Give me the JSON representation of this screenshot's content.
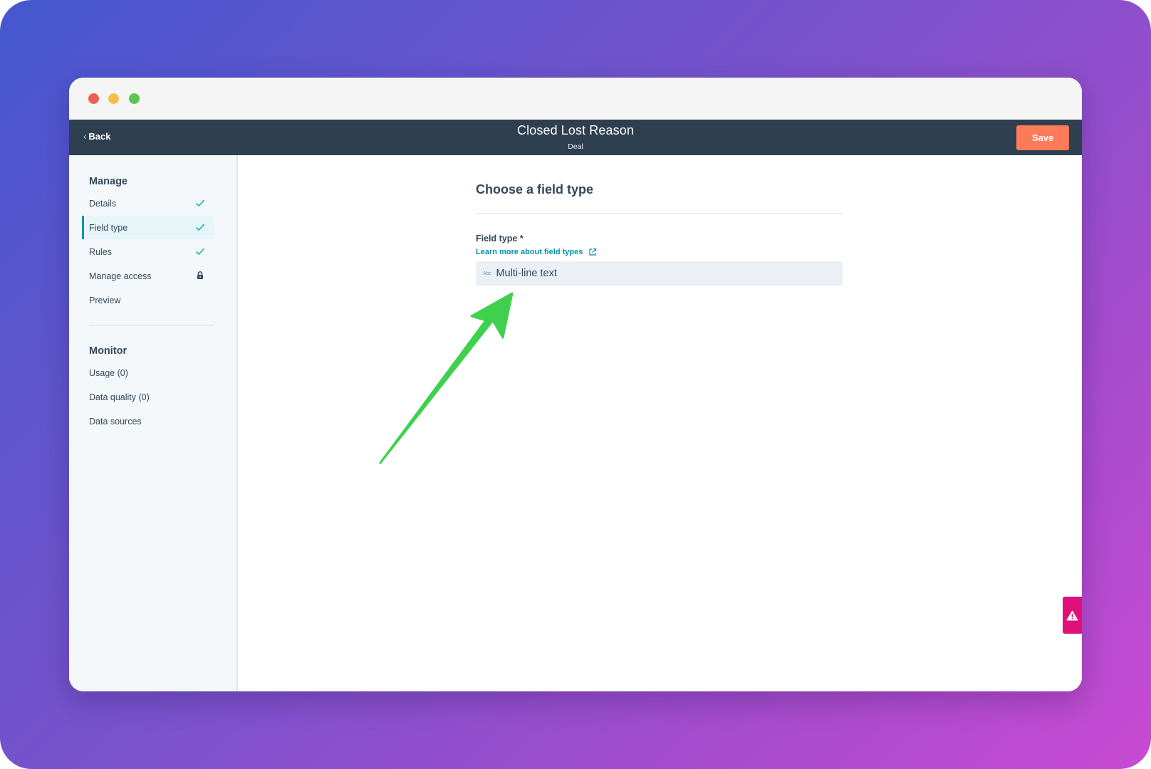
{
  "app_bar": {
    "back_label": "Back",
    "title": "Closed Lost Reason",
    "subtitle": "Deal",
    "save_label": "Save"
  },
  "sidebar": {
    "manage_heading": "Manage",
    "manage_items": [
      {
        "label": "Details",
        "status": "check-icon"
      },
      {
        "label": "Field type",
        "status": "check-icon",
        "active": true
      },
      {
        "label": "Rules",
        "status": "check-icon"
      },
      {
        "label": "Manage access",
        "status": "lock-icon"
      },
      {
        "label": "Preview"
      }
    ],
    "monitor_heading": "Monitor",
    "monitor_items": [
      {
        "label": "Usage (0)"
      },
      {
        "label": "Data quality (0)"
      },
      {
        "label": "Data sources"
      }
    ]
  },
  "main": {
    "heading": "Choose a field type",
    "field_label": "Field type *",
    "learn_link": "Learn more about field types",
    "select_icon_text": "Abc",
    "select_value": "Multi-line text"
  },
  "colors": {
    "accent": "#0091ae",
    "save_button": "#ff7a59",
    "app_bar": "#2e3f50",
    "check": "#00bda5",
    "arrow": "#3fd14e",
    "alert": "#e0107a"
  }
}
